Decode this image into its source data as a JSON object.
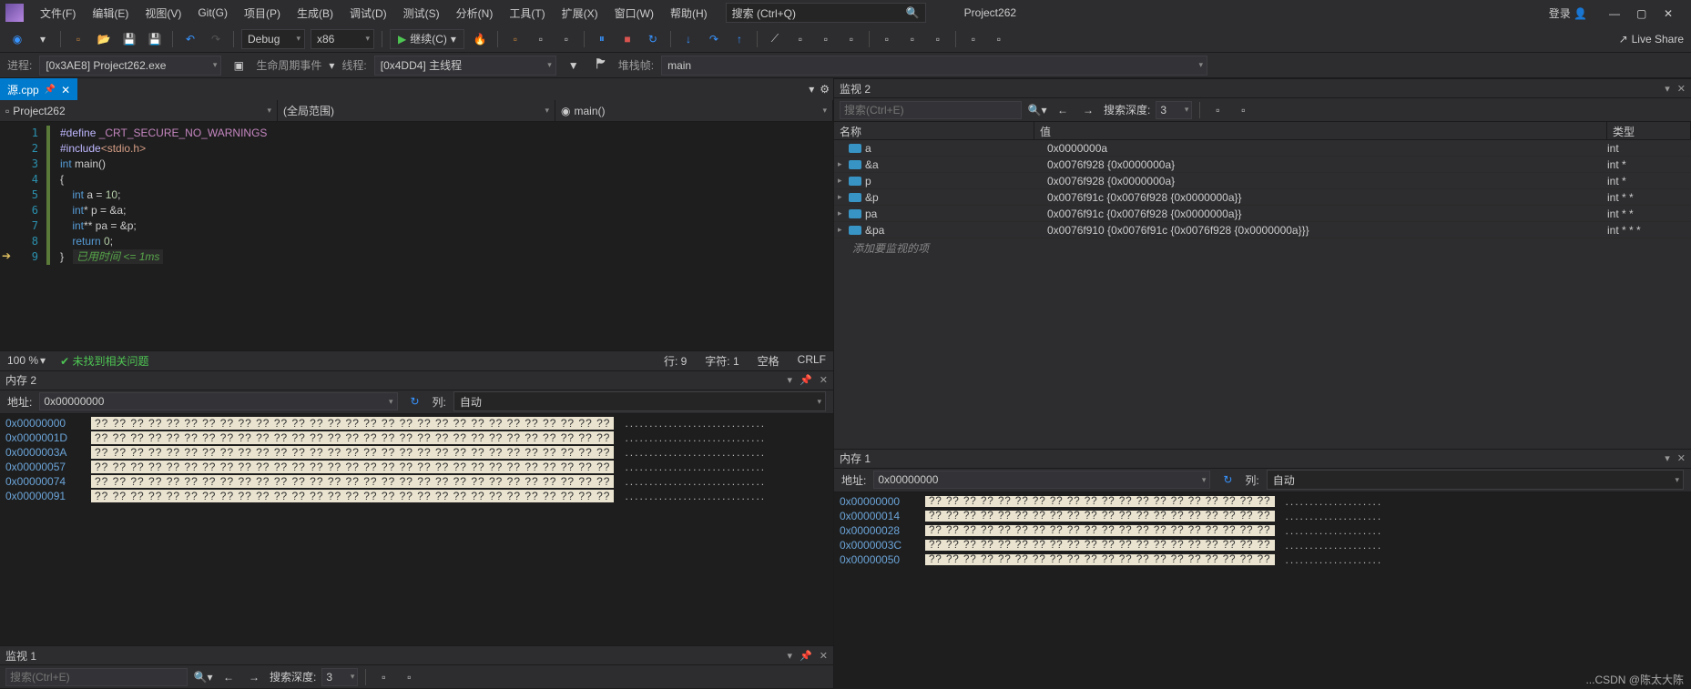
{
  "menu": {
    "items": [
      "文件(F)",
      "编辑(E)",
      "视图(V)",
      "Git(G)",
      "项目(P)",
      "生成(B)",
      "调试(D)",
      "测试(S)",
      "分析(N)",
      "工具(T)",
      "扩展(X)",
      "窗口(W)",
      "帮助(H)"
    ],
    "search_placeholder": "搜索 (Ctrl+Q)",
    "solution": "Project262",
    "login": "登录"
  },
  "toolbar": {
    "config": "Debug",
    "platform": "x86",
    "continue": "继续(C)",
    "liveshare": "Live Share"
  },
  "debug": {
    "process_label": "进程:",
    "process": "[0x3AE8] Project262.exe",
    "lifecycle": "生命周期事件",
    "thread_label": "线程:",
    "thread": "[0x4DD4] 主线程",
    "stack_label": "堆栈帧:",
    "stack": "main"
  },
  "tab": {
    "name": "源.cpp"
  },
  "scopes": {
    "proj": "Project262",
    "range": "(全局范围)",
    "func": "main()"
  },
  "code": {
    "lines": [
      {
        "n": "1",
        "html": "<span class='mac'>#define </span><span class='macname'>_CRT_SECURE_NO_WARNINGS</span>"
      },
      {
        "n": "2",
        "html": "<span class='mac'>#include</span><span class='inc'>&lt;stdio.h&gt;</span>"
      },
      {
        "n": "3",
        "html": "<span class='type'>int</span> <span>main</span>()"
      },
      {
        "n": "4",
        "html": "{"
      },
      {
        "n": "5",
        "html": "    <span class='type'>int</span> a = <span class='num'>10</span>;"
      },
      {
        "n": "6",
        "html": "    <span class='type'>int</span>* p = &amp;a;"
      },
      {
        "n": "7",
        "html": "    <span class='type'>int</span>** pa = &amp;p;"
      },
      {
        "n": "8",
        "html": "    <span class='kw'>return</span> <span class='num'>0</span>;"
      },
      {
        "n": "9",
        "html": "}   <span class='cmt'>已用时间 &lt;= 1ms</span>"
      }
    ]
  },
  "status": {
    "zoom": "100 %",
    "ok": "未找到相关问题",
    "line": "行: 9",
    "char": "字符: 1",
    "space": "空格",
    "crlf": "CRLF"
  },
  "mem2": {
    "title": "内存 2",
    "addr_label": "地址:",
    "addr": "0x00000000",
    "col_label": "列:",
    "col": "自动",
    "rows": [
      {
        "a": "0x00000000",
        "b": "?? ?? ?? ?? ?? ?? ?? ?? ?? ?? ?? ?? ?? ?? ?? ?? ?? ?? ?? ?? ?? ?? ?? ?? ?? ?? ?? ?? ??",
        "c": "............................."
      },
      {
        "a": "0x0000001D",
        "b": "?? ?? ?? ?? ?? ?? ?? ?? ?? ?? ?? ?? ?? ?? ?? ?? ?? ?? ?? ?? ?? ?? ?? ?? ?? ?? ?? ?? ??",
        "c": "............................."
      },
      {
        "a": "0x0000003A",
        "b": "?? ?? ?? ?? ?? ?? ?? ?? ?? ?? ?? ?? ?? ?? ?? ?? ?? ?? ?? ?? ?? ?? ?? ?? ?? ?? ?? ?? ??",
        "c": "............................."
      },
      {
        "a": "0x00000057",
        "b": "?? ?? ?? ?? ?? ?? ?? ?? ?? ?? ?? ?? ?? ?? ?? ?? ?? ?? ?? ?? ?? ?? ?? ?? ?? ?? ?? ?? ??",
        "c": "............................."
      },
      {
        "a": "0x00000074",
        "b": "?? ?? ?? ?? ?? ?? ?? ?? ?? ?? ?? ?? ?? ?? ?? ?? ?? ?? ?? ?? ?? ?? ?? ?? ?? ?? ?? ?? ??",
        "c": "............................."
      },
      {
        "a": "0x00000091",
        "b": "?? ?? ?? ?? ?? ?? ?? ?? ?? ?? ?? ?? ?? ?? ?? ?? ?? ?? ?? ?? ?? ?? ?? ?? ?? ?? ?? ?? ??",
        "c": "............................."
      }
    ]
  },
  "watch1": {
    "title": "监视 1",
    "search": "搜索(Ctrl+E)",
    "depth_label": "搜索深度:",
    "depth": "3"
  },
  "watch2": {
    "title": "监视 2",
    "search": "搜索(Ctrl+E)",
    "depth_label": "搜索深度:",
    "depth": "3",
    "headers": {
      "name": "名称",
      "value": "值",
      "type": "类型"
    },
    "rows": [
      {
        "exp": "",
        "name": "a",
        "value": "0x0000000a",
        "type": "int"
      },
      {
        "exp": "▸",
        "name": "&a",
        "value": "0x0076f928 {0x0000000a}",
        "type": "int *"
      },
      {
        "exp": "▸",
        "name": "p",
        "value": "0x0076f928 {0x0000000a}",
        "type": "int *"
      },
      {
        "exp": "▸",
        "name": "&p",
        "value": "0x0076f91c {0x0076f928 {0x0000000a}}",
        "type": "int * *"
      },
      {
        "exp": "▸",
        "name": "pa",
        "value": "0x0076f91c {0x0076f928 {0x0000000a}}",
        "type": "int * *"
      },
      {
        "exp": "▸",
        "name": "&pa",
        "value": "0x0076f910 {0x0076f91c {0x0076f928 {0x0000000a}}}",
        "type": "int * * *"
      }
    ],
    "add": "添加要监视的项"
  },
  "mem1": {
    "title": "内存 1",
    "addr_label": "地址:",
    "addr": "0x00000000",
    "col_label": "列:",
    "col": "自动",
    "rows": [
      {
        "a": "0x00000000",
        "b": "?? ?? ?? ?? ?? ?? ?? ?? ?? ?? ?? ?? ?? ?? ?? ?? ?? ?? ?? ??",
        "c": "...................."
      },
      {
        "a": "0x00000014",
        "b": "?? ?? ?? ?? ?? ?? ?? ?? ?? ?? ?? ?? ?? ?? ?? ?? ?? ?? ?? ??",
        "c": "...................."
      },
      {
        "a": "0x00000028",
        "b": "?? ?? ?? ?? ?? ?? ?? ?? ?? ?? ?? ?? ?? ?? ?? ?? ?? ?? ?? ??",
        "c": "...................."
      },
      {
        "a": "0x0000003C",
        "b": "?? ?? ?? ?? ?? ?? ?? ?? ?? ?? ?? ?? ?? ?? ?? ?? ?? ?? ?? ??",
        "c": "...................."
      },
      {
        "a": "0x00000050",
        "b": "?? ?? ?? ?? ?? ?? ?? ?? ?? ?? ?? ?? ?? ?? ?? ?? ?? ?? ?? ??",
        "c": "...................."
      }
    ]
  },
  "watermark": "...CSDN @陈太大陈"
}
